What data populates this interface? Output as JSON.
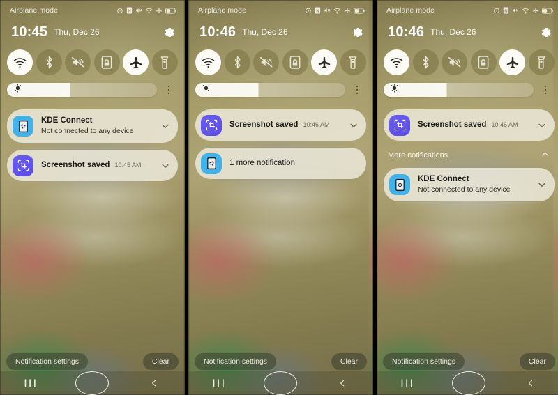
{
  "meta": {
    "device": "android-notification-shade",
    "panel_count": 3
  },
  "statusbar": {
    "left_label": "Airplane mode",
    "icons": [
      "alarm-icon",
      "nfc-icon",
      "mute-icon",
      "wifi-icon",
      "airplane-icon",
      "battery-icon"
    ]
  },
  "quick_toggles": [
    {
      "name": "wifi",
      "label": "Wi-Fi",
      "icon": "wifi-icon",
      "active": true
    },
    {
      "name": "bluetooth",
      "label": "Bluetooth",
      "icon": "bluetooth-icon",
      "active": false
    },
    {
      "name": "sound",
      "label": "Mute",
      "icon": "sound-mute-icon",
      "active": false
    },
    {
      "name": "screen-lock",
      "label": "Auto rotate",
      "icon": "screen-lock-icon",
      "active": false
    },
    {
      "name": "airplane-mode",
      "label": "Airplane mode",
      "icon": "airplane-icon",
      "active": true
    },
    {
      "name": "flashlight",
      "label": "Flashlight",
      "icon": "flashlight-icon",
      "active": false
    }
  ],
  "brightness": {
    "icon": "brightness-icon",
    "value_percent": 42,
    "menu_icon": "kebab-menu-icon"
  },
  "bottom_bar": {
    "settings_label": "Notification settings",
    "clear_label": "Clear"
  },
  "navbar": {
    "recents_icon": "recents-icon",
    "recents_glyph": "III",
    "home_icon": "home-icon",
    "back_icon": "back-icon"
  },
  "panels": [
    {
      "id": "panel-1",
      "clock": "10:45",
      "date": "Thu, Dec 26",
      "gear_icon": "settings-gear-icon",
      "notifications": [
        {
          "icon": "kde-connect-icon",
          "icon_style": "kde",
          "title": "KDE Connect",
          "time": "",
          "body": "Not connected to any device",
          "expand_icon": "chevron-down-icon"
        },
        {
          "icon": "screenshot-icon",
          "icon_style": "shot",
          "title": "Screenshot saved",
          "time": "10:45 AM",
          "body": "",
          "expand_icon": "chevron-down-icon"
        }
      ],
      "more_section": null
    },
    {
      "id": "panel-2",
      "clock": "10:46",
      "date": "Thu, Dec 26",
      "gear_icon": "settings-gear-icon",
      "notifications": [
        {
          "icon": "screenshot-icon",
          "icon_style": "shot",
          "title": "Screenshot saved",
          "time": "10:46 AM",
          "body": "",
          "expand_icon": "chevron-down-icon"
        },
        {
          "icon": "kde-connect-icon",
          "icon_style": "kde",
          "title": "1 more notification",
          "time": "",
          "body": "",
          "expand_icon": ""
        }
      ],
      "more_section": null
    },
    {
      "id": "panel-3",
      "clock": "10:46",
      "date": "Thu, Dec 26",
      "gear_icon": "settings-gear-icon",
      "notifications": [
        {
          "icon": "screenshot-icon",
          "icon_style": "shot",
          "title": "Screenshot saved",
          "time": "10:46 AM",
          "body": "",
          "expand_icon": "chevron-down-icon"
        }
      ],
      "more_section": {
        "label": "More notifications",
        "collapse_icon": "chevron-up-icon",
        "notifications": [
          {
            "icon": "kde-connect-icon",
            "icon_style": "kde",
            "title": "KDE Connect",
            "time": "",
            "body": "Not connected to any device",
            "expand_icon": "chevron-down-icon"
          }
        ]
      }
    }
  ],
  "colors": {
    "accent_kde": "#42b2e8",
    "accent_screenshot": "#5b4ae8",
    "notification_card": "#f0ede0",
    "wallpaper_base": "#a99f6b",
    "toggle_on": "#fcfbf6",
    "toggle_off": "#7e7646"
  }
}
